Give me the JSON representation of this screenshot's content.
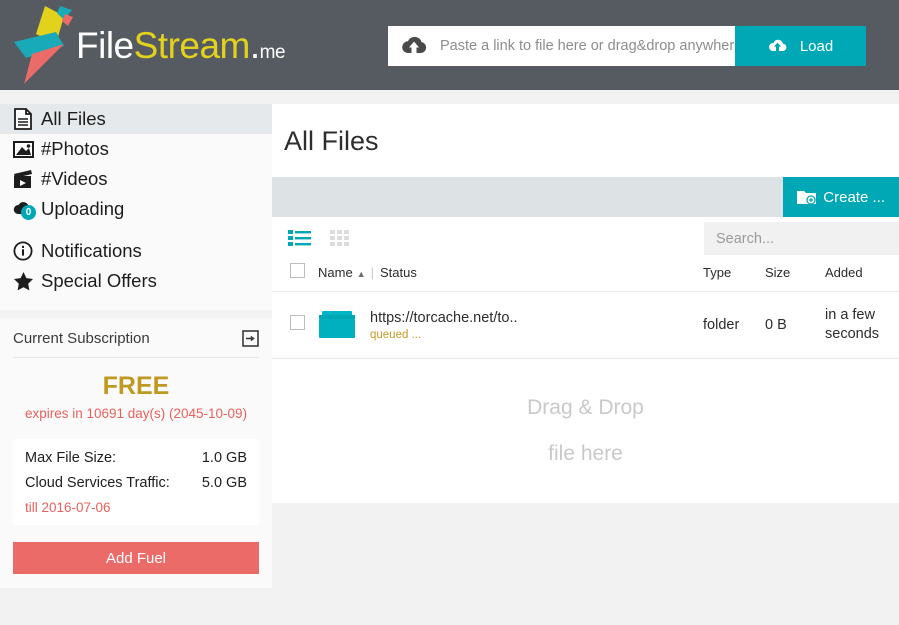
{
  "header": {
    "logo": {
      "icon": "parrot-logo-icon",
      "text_file": "File",
      "text_stream": "Stream",
      "text_dot": ".",
      "text_me": "me"
    },
    "load": {
      "input_placeholder": "Paste a link to file here or drag&drop anywhere",
      "input_value": "",
      "input_icon": "cloud-upload-icon",
      "button_label": "Load",
      "button_icon": "cloud-upload-icon"
    }
  },
  "sidebar": {
    "items": [
      {
        "label": "All Files",
        "icon": "document-icon",
        "active": true
      },
      {
        "label": "#Photos",
        "icon": "image-icon",
        "active": false
      },
      {
        "label": "#Videos",
        "icon": "film-clapper-icon",
        "active": false
      },
      {
        "label": "Uploading",
        "icon": "upload-cloud-icon",
        "active": false,
        "badge": "0"
      },
      {
        "label": "Notifications",
        "icon": "info-circle-icon",
        "active": false
      },
      {
        "label": "Special Offers",
        "icon": "star-icon",
        "active": false
      }
    ],
    "subscription": {
      "title": "Current Subscription",
      "exit_icon": "sign-out-icon",
      "plan": "FREE",
      "expires": "expires in 10691 day(s) (2045-10-09)",
      "quota": [
        {
          "label": "Max File Size:",
          "value": "1.0 GB"
        },
        {
          "label": "Cloud Services Traffic:",
          "value": "5.0 GB",
          "note": "till 2016-07-06"
        }
      ],
      "add_fuel_label": "Add Fuel"
    }
  },
  "main": {
    "title": "All Files",
    "create_button": {
      "label": "Create ...",
      "icon": "folder-add-icon"
    },
    "views": [
      {
        "name": "list-view-icon",
        "active": true
      },
      {
        "name": "grid-view-icon",
        "active": false
      }
    ],
    "search": {
      "placeholder": "Search...",
      "value": ""
    },
    "table": {
      "columns": [
        "Name",
        "Status",
        "Type",
        "Size",
        "Added"
      ],
      "sort_column": "Name",
      "sort_direction": "asc",
      "rows": [
        {
          "icon": "folder-icon",
          "name": "https://torcache.net/to..",
          "status": "queued ...",
          "type": "folder",
          "size": "0 B",
          "added": "in a few seconds"
        }
      ]
    },
    "dropzone": {
      "line1": "Drag & Drop",
      "line2": "file here"
    }
  },
  "colors": {
    "teal": "#00a7b5",
    "header_gray": "#555b60",
    "coral": "#ea6b68",
    "gold": "#bf9a23",
    "logo_yellow": "#e3d21c"
  }
}
